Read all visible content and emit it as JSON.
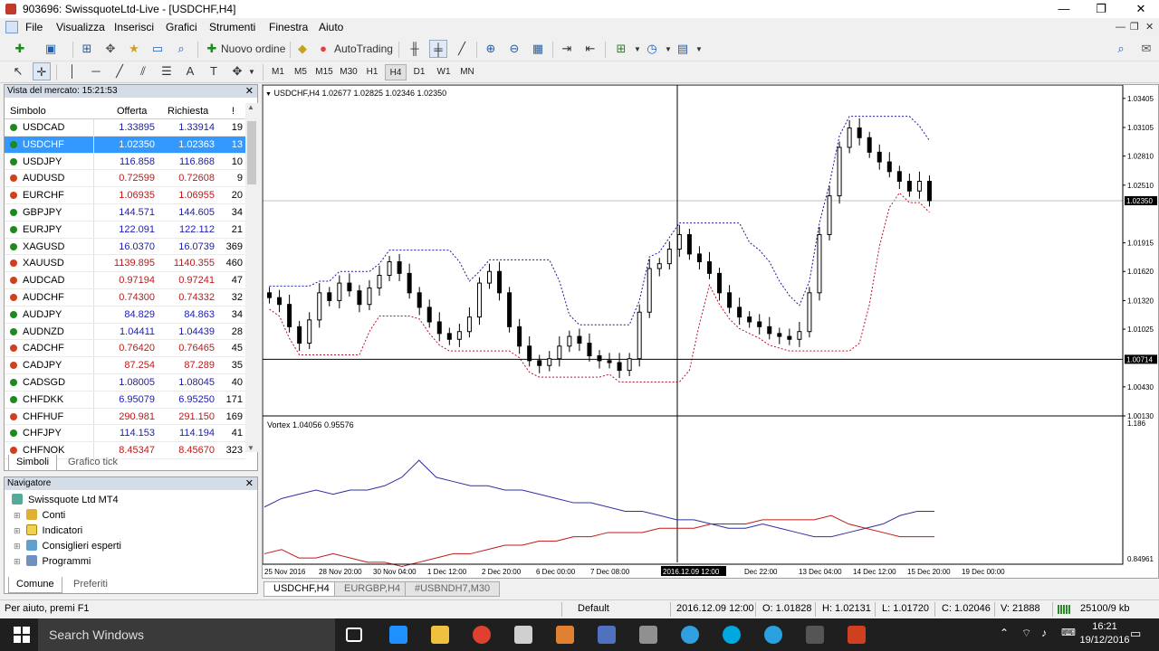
{
  "window": {
    "title": "903696: SwissquoteLtd-Live - [USDCHF,H4]",
    "minimize": "—",
    "maximize": "❐",
    "close": "✕"
  },
  "menu": {
    "items": [
      "File",
      "Visualizza",
      "Inserisci",
      "Grafici",
      "Strumenti",
      "Finestra",
      "Aiuto"
    ]
  },
  "toolbar": {
    "new_order": "Nuovo ordine",
    "autotrading": "AutoTrading",
    "timeframes": [
      "M1",
      "M5",
      "M15",
      "M30",
      "H1",
      "H4",
      "D1",
      "W1",
      "MN"
    ],
    "active_timeframe": "H4"
  },
  "market_watch": {
    "title": "Vista del mercato: 15:21:53",
    "headers": {
      "symbol": "Simbolo",
      "bid": "Offerta",
      "ask": "Richiesta",
      "spread": "!"
    },
    "rows": [
      {
        "s": "USDCAD",
        "b": "1.33895",
        "a": "1.33914",
        "p": "19",
        "up": true
      },
      {
        "s": "USDCHF",
        "b": "1.02350",
        "a": "1.02363",
        "p": "13",
        "up": true
      },
      {
        "s": "USDJPY",
        "b": "116.858",
        "a": "116.868",
        "p": "10",
        "up": true
      },
      {
        "s": "AUDUSD",
        "b": "0.72599",
        "a": "0.72608",
        "p": "9",
        "up": false
      },
      {
        "s": "EURCHF",
        "b": "1.06935",
        "a": "1.06955",
        "p": "20",
        "up": false
      },
      {
        "s": "GBPJPY",
        "b": "144.571",
        "a": "144.605",
        "p": "34",
        "up": true
      },
      {
        "s": "EURJPY",
        "b": "122.091",
        "a": "122.112",
        "p": "21",
        "up": true
      },
      {
        "s": "XAGUSD",
        "b": "16.0370",
        "a": "16.0739",
        "p": "369",
        "up": true
      },
      {
        "s": "XAUUSD",
        "b": "1139.895",
        "a": "1140.355",
        "p": "460",
        "up": false
      },
      {
        "s": "AUDCAD",
        "b": "0.97194",
        "a": "0.97241",
        "p": "47",
        "up": false
      },
      {
        "s": "AUDCHF",
        "b": "0.74300",
        "a": "0.74332",
        "p": "32",
        "up": false
      },
      {
        "s": "AUDJPY",
        "b": "84.829",
        "a": "84.863",
        "p": "34",
        "up": true
      },
      {
        "s": "AUDNZD",
        "b": "1.04411",
        "a": "1.04439",
        "p": "28",
        "up": true
      },
      {
        "s": "CADCHF",
        "b": "0.76420",
        "a": "0.76465",
        "p": "45",
        "up": false
      },
      {
        "s": "CADJPY",
        "b": "87.254",
        "a": "87.289",
        "p": "35",
        "up": false
      },
      {
        "s": "CADSGD",
        "b": "1.08005",
        "a": "1.08045",
        "p": "40",
        "up": true
      },
      {
        "s": "CHFDKK",
        "b": "6.95079",
        "a": "6.95250",
        "p": "171",
        "up": true
      },
      {
        "s": "CHFHUF",
        "b": "290.981",
        "a": "291.150",
        "p": "169",
        "up": false
      },
      {
        "s": "CHFJPY",
        "b": "114.153",
        "a": "114.194",
        "p": "41",
        "up": true
      },
      {
        "s": "CHFNOK",
        "b": "8.45347",
        "a": "8.45670",
        "p": "323",
        "up": false
      }
    ],
    "tabs": [
      "Simboli",
      "Grafico tick"
    ]
  },
  "navigator": {
    "title": "Navigatore",
    "root": "Swissquote Ltd MT4",
    "items": [
      "Conti",
      "Indicatori",
      "Consiglieri esperti",
      "Programmi"
    ],
    "tabs": [
      "Comune",
      "Preferiti"
    ]
  },
  "chart": {
    "header": "USDCHF,H4  1.02677 1.02825 1.02346 1.02350",
    "indicator_header": "Vortex 1.04056 0.95576",
    "price_ticks": [
      "1.03405",
      "1.03105",
      "1.02810",
      "1.02510",
      "1.02350",
      "1.01915",
      "1.01620",
      "1.01320",
      "1.01025",
      "1.00714",
      "1.00430",
      "1.00130"
    ],
    "current_price": "1.02350",
    "crosshair_price": "1.00714",
    "indicator_ticks": [
      "1.186",
      "0.84961"
    ],
    "time_ticks": [
      "25 Nov 2016",
      "28 Nov 20:00",
      "30 Nov 04:00",
      "1 Dec 12:00",
      "2 Dec 20:00",
      "6 Dec 00:00",
      "7 Dec 08:00",
      "2016.12.09 12:00",
      "Dec 22:00",
      "13 Dec 04:00",
      "14 Dec 12:00",
      "15 Dec 20:00",
      "19 Dec 00:00"
    ],
    "colors": {
      "bull": "#ffffff",
      "bear": "#000000",
      "upper": "#1a1aa0",
      "lower": "#c0102a",
      "vi_plus": "#3030a0",
      "vi_minus": "#c01818"
    }
  },
  "chart_data": {
    "type": "line",
    "title": "USDCHF,H4",
    "ylim": [
      1.0013,
      1.0345
    ],
    "price_series": [
      1.0135,
      1.0128,
      1.0105,
      1.0088,
      1.0112,
      1.014,
      1.0132,
      1.015,
      1.0142,
      1.0128,
      1.0145,
      1.0158,
      1.0172,
      1.016,
      1.014,
      1.0125,
      1.011,
      1.0098,
      1.0092,
      1.01,
      1.0115,
      1.015,
      1.0162,
      1.014,
      1.0105,
      1.0085,
      1.007,
      1.0065,
      1.0072,
      1.0085,
      1.0095,
      1.0088,
      1.0075,
      1.007,
      1.0068,
      1.006,
      1.0072,
      1.012,
      1.0165,
      1.017,
      1.0185,
      1.02,
      1.018,
      1.0172,
      1.016,
      1.014,
      1.0125,
      1.0115,
      1.011,
      1.0105,
      1.0098,
      1.0095,
      1.0092,
      1.01,
      1.014,
      1.02,
      1.024,
      1.029,
      1.031,
      1.03,
      1.0285,
      1.0275,
      1.0265,
      1.0255,
      1.0245,
      1.0255,
      1.0235
    ],
    "vortex_plus": [
      0.98,
      1.0,
      1.01,
      1.02,
      1.01,
      1.02,
      1.02,
      1.03,
      1.05,
      1.09,
      1.05,
      1.04,
      1.03,
      1.03,
      1.02,
      1.02,
      1.01,
      1.0,
      0.99,
      0.99,
      0.98,
      0.97,
      0.97,
      0.96,
      0.95,
      0.95,
      0.94,
      0.93,
      0.93,
      0.94,
      0.93,
      0.92,
      0.91,
      0.91,
      0.92,
      0.93,
      0.94,
      0.96,
      0.97,
      0.97
    ],
    "vortex_minus": [
      0.87,
      0.88,
      0.86,
      0.86,
      0.87,
      0.86,
      0.85,
      0.85,
      0.84,
      0.85,
      0.86,
      0.87,
      0.87,
      0.88,
      0.89,
      0.89,
      0.9,
      0.9,
      0.91,
      0.91,
      0.92,
      0.92,
      0.92,
      0.93,
      0.93,
      0.93,
      0.94,
      0.94,
      0.94,
      0.95,
      0.95,
      0.95,
      0.95,
      0.96,
      0.94,
      0.93,
      0.92,
      0.91,
      0.91,
      0.91
    ],
    "indicator_ylim": [
      0.84961,
      1.186
    ]
  },
  "chart_tabs": [
    "USDCHF,H4",
    "EURGBP,H4",
    "#USBNDH7,M30"
  ],
  "status": {
    "help": "Per aiuto, premi F1",
    "profile": "Default",
    "time": "2016.12.09 12:00",
    "open": "O: 1.01828",
    "high": "H: 1.02131",
    "low": "L: 1.01720",
    "close": "C: 1.02046",
    "volume": "V: 21888",
    "traffic": "25100/9 kb"
  },
  "taskbar": {
    "search": "Search Windows",
    "time": "16:21",
    "date": "19/12/2016"
  }
}
